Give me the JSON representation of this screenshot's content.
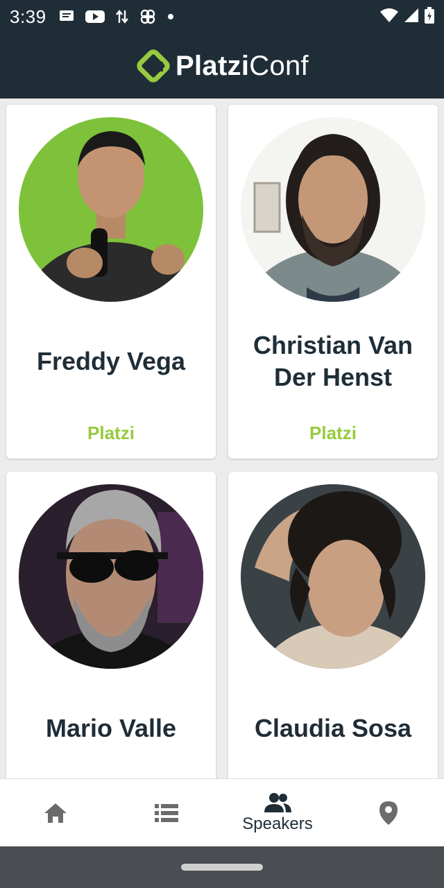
{
  "status_bar": {
    "time": "3:39",
    "icons": [
      "message-icon",
      "youtube-icon",
      "data-transfer-icon",
      "pinwheel-icon",
      "dot-icon",
      "wifi-icon",
      "signal-icon",
      "battery-icon"
    ]
  },
  "app": {
    "logo_bold": "Platzi",
    "logo_light": "Conf",
    "accent_color": "#98ca3f",
    "bar_color": "#1f2d37"
  },
  "speakers": [
    {
      "name": "Freddy Vega",
      "company": "Platzi"
    },
    {
      "name": "Christian Van Der Henst",
      "company": "Platzi"
    },
    {
      "name": "Mario Valle",
      "company": ""
    },
    {
      "name": "Claudia Sosa",
      "company": ""
    }
  ],
  "bottom_nav": {
    "items": [
      {
        "icon": "home-icon",
        "label": ""
      },
      {
        "icon": "list-icon",
        "label": ""
      },
      {
        "icon": "speakers-icon",
        "label": "Speakers",
        "active": true
      },
      {
        "icon": "location-pin-icon",
        "label": ""
      }
    ]
  }
}
